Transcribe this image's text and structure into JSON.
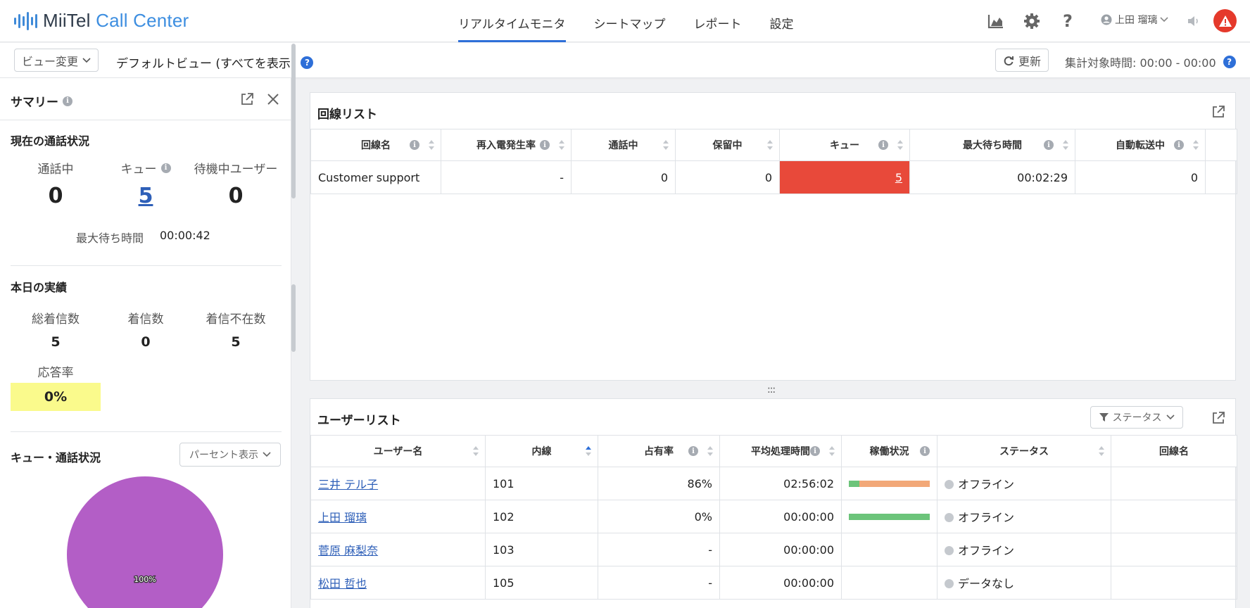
{
  "app": {
    "brand_left": "MiiTel",
    "brand_right": "Call Center"
  },
  "nav": {
    "tabs": [
      "リアルタイムモニタ",
      "シートマップ",
      "レポート",
      "設定"
    ],
    "active_tab": "リアルタイムモニタ",
    "user_name": "上田 瑠璃"
  },
  "toolbar": {
    "view_change_label": "ビュー変更",
    "view_name": "デフォルトビュー (すべてを表示)",
    "refresh_label": "更新",
    "period_label": "集計対象時間: 00:00 - 00:00"
  },
  "summary": {
    "title": "サマリー",
    "current_section": "現在の通話状況",
    "current": {
      "in_call_label": "通話中",
      "in_call_value": "0",
      "queue_label": "キュー",
      "queue_value": "5",
      "waiting_label": "待機中ユーザー",
      "waiting_value": "0"
    },
    "max_wait_label": "最大待ち時間",
    "max_wait_value": "00:00:42",
    "today_section": "本日の実績",
    "today": {
      "total_label": "総着信数",
      "total_value": "5",
      "received_label": "着信数",
      "received_value": "0",
      "missed_label": "着信不在数",
      "missed_value": "5",
      "rate_label": "応答率",
      "rate_value": "0%"
    },
    "queue_section": "キュー・通話状況",
    "display_select": "パーセント表示",
    "pie_label": "100%"
  },
  "colors": {
    "accent": "#2e6fd8",
    "alert": "#e5392b",
    "queue_hot": "#e8493a",
    "rate_highlight": "#fafa8c",
    "pie": "#b35ec6",
    "bar_green": "#6cc47a",
    "bar_orange": "#f2a878"
  },
  "lines": {
    "title": "回線リスト",
    "columns": [
      "回線名",
      "再入電発生率",
      "通話中",
      "保留中",
      "キュー",
      "最大待ち時間",
      "自動転送中"
    ],
    "rows": [
      {
        "name": "Customer support",
        "reentry": "-",
        "in_call": "0",
        "hold": "0",
        "queue": "5",
        "max_wait": "00:02:29",
        "auto_forward": "0"
      }
    ]
  },
  "users": {
    "title": "ユーザーリスト",
    "status_filter": "ステータス",
    "columns": [
      "ユーザー名",
      "内線",
      "占有率",
      "平均処理時間",
      "稼働状況",
      "ステータス",
      "回線名"
    ],
    "rows": [
      {
        "name": "三井 テル子",
        "ext": "101",
        "occupancy": "86%",
        "avg_time": "02:56:02",
        "status": "オフライン",
        "line": "",
        "activity": {
          "green": 0.13,
          "orange": 0.87
        }
      },
      {
        "name": "上田 瑠璃",
        "ext": "102",
        "occupancy": "0%",
        "avg_time": "00:00:00",
        "status": "オフライン",
        "line": "",
        "activity": {
          "green": 1.0,
          "orange": 0.0
        }
      },
      {
        "name": "菅原 麻梨奈",
        "ext": "103",
        "occupancy": "-",
        "avg_time": "00:00:00",
        "status": "オフライン",
        "line": "",
        "activity": null
      },
      {
        "name": "松田 哲也",
        "ext": "105",
        "occupancy": "-",
        "avg_time": "00:00:00",
        "status": "データなし",
        "line": "",
        "activity": null
      }
    ]
  }
}
